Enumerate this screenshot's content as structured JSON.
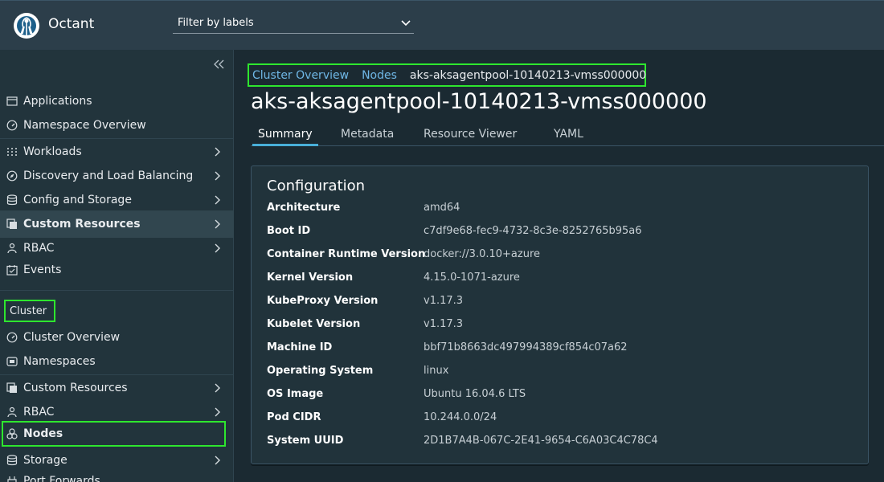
{
  "header": {
    "app_name": "Octant",
    "filter_placeholder": "Filter by labels"
  },
  "sidebar": {
    "items": [
      {
        "label": "Applications",
        "icon": "window-icon",
        "chevron": false
      },
      {
        "label": "Namespace Overview",
        "icon": "dashboard-icon",
        "chevron": false
      },
      {
        "label": "Workloads",
        "icon": "grid-icon",
        "chevron": true
      },
      {
        "label": "Discovery and Load Balancing",
        "icon": "compass-icon",
        "chevron": true
      },
      {
        "label": "Config and Storage",
        "icon": "database-icon",
        "chevron": true
      },
      {
        "label": "Custom Resources",
        "icon": "copy-icon",
        "chevron": true,
        "active": true
      },
      {
        "label": "RBAC",
        "icon": "person-icon",
        "chevron": true
      },
      {
        "label": "Events",
        "icon": "calendar-icon",
        "chevron": false
      }
    ],
    "section_label": "Cluster",
    "cluster_items": [
      {
        "label": "Cluster Overview",
        "icon": "dashboard-icon",
        "chevron": false
      },
      {
        "label": "Namespaces",
        "icon": "namespace-icon",
        "chevron": false
      },
      {
        "label": "Custom Resources",
        "icon": "copy-icon",
        "chevron": true
      },
      {
        "label": "RBAC",
        "icon": "person-icon",
        "chevron": true
      },
      {
        "label": "Nodes",
        "icon": "nodes-icon",
        "chevron": false
      },
      {
        "label": "Storage",
        "icon": "database-icon",
        "chevron": true
      },
      {
        "label": "Port Forwards",
        "icon": "plug-icon",
        "chevron": false
      }
    ]
  },
  "breadcrumb": {
    "items": [
      "Cluster Overview",
      "Nodes"
    ],
    "current": "aks-aksagentpool-10140213-vmss000000"
  },
  "page": {
    "title": "aks-aksagentpool-10140213-vmss000000"
  },
  "tabs": [
    "Summary",
    "Metadata",
    "Resource Viewer",
    "YAML"
  ],
  "configuration": {
    "title": "Configuration",
    "rows": [
      {
        "key": "Architecture",
        "value": "amd64"
      },
      {
        "key": "Boot ID",
        "value": "c7df9e68-fec9-4732-8c3e-8252765b95a6"
      },
      {
        "key": "Container Runtime Version",
        "value": "docker://3.0.10+azure"
      },
      {
        "key": "Kernel Version",
        "value": "4.15.0-1071-azure"
      },
      {
        "key": "KubeProxy Version",
        "value": "v1.17.3"
      },
      {
        "key": "Kubelet Version",
        "value": "v1.17.3"
      },
      {
        "key": "Machine ID",
        "value": "bbf71b8663dc497994389cf854c07a62"
      },
      {
        "key": "Operating System",
        "value": "linux"
      },
      {
        "key": "OS Image",
        "value": "Ubuntu 16.04.6 LTS"
      },
      {
        "key": "Pod CIDR",
        "value": "10.244.0.0/24"
      },
      {
        "key": "System UUID",
        "value": "2D1B7A4B-067C-2E41-9654-C6A03C4C78C4"
      }
    ]
  },
  "colors": {
    "accent": "#49afd9",
    "highlight": "#2ee62e",
    "link": "#6fb7e6"
  }
}
